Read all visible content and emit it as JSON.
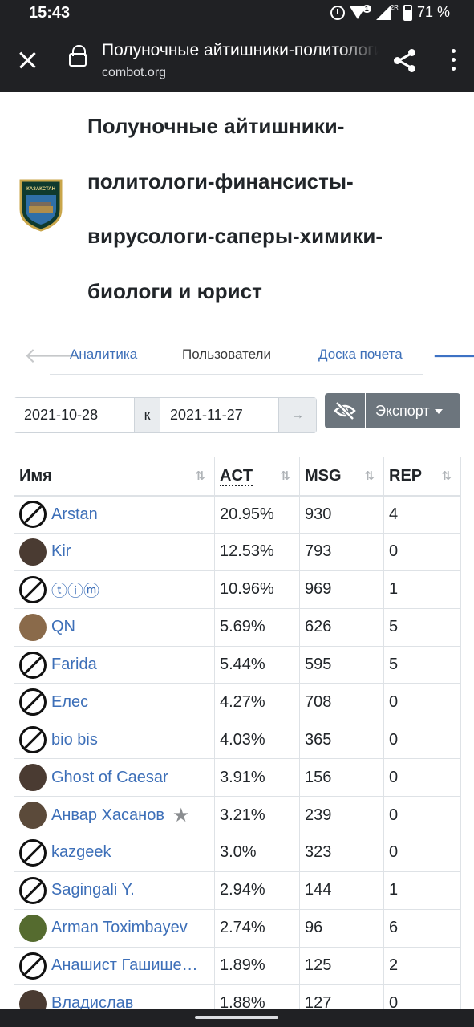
{
  "status_bar": {
    "time": "15:43",
    "badge": "1",
    "network": "2R",
    "battery": "71 %"
  },
  "browser": {
    "page_title": "Полуночные айтишники-политологи-финансисты",
    "url": "combot.org",
    "icons": [
      "close-icon",
      "lock-icon",
      "share-icon",
      "more-vert-icon"
    ]
  },
  "group": {
    "title": "Полуночные айтишники-политологи-финансисты-вирусологи-саперы-химики-биологи и юрист",
    "logo_text": "КАЗАКСТАН"
  },
  "tabs": {
    "items": [
      "Аналитика",
      "Пользователи",
      "Доска почета"
    ],
    "active": "Пользователи"
  },
  "filters": {
    "date_from": "2021-10-28",
    "separator": "к",
    "date_to": "2021-11-27",
    "go": "→",
    "export_label": "Экспорт"
  },
  "table": {
    "headers": [
      "Имя",
      "ACT",
      "MSG",
      "REP"
    ],
    "sort_icon": "⇅",
    "rows": [
      {
        "name": "Arstan",
        "act": "20.95%",
        "msg": "930",
        "rep": "4",
        "avatar": "ban"
      },
      {
        "name": "Kir",
        "act": "12.53%",
        "msg": "793",
        "rep": "0",
        "avatar": "photo"
      },
      {
        "name": "ⓣⓘⓜ",
        "act": "10.96%",
        "msg": "969",
        "rep": "1",
        "avatar": "ban"
      },
      {
        "name": "QN",
        "act": "5.69%",
        "msg": "626",
        "rep": "5",
        "avatar": "photo"
      },
      {
        "name": "Farida",
        "act": "5.44%",
        "msg": "595",
        "rep": "5",
        "avatar": "ban"
      },
      {
        "name": "Елес",
        "act": "4.27%",
        "msg": "708",
        "rep": "0",
        "avatar": "ban"
      },
      {
        "name": "bio bis",
        "act": "4.03%",
        "msg": "365",
        "rep": "0",
        "avatar": "ban"
      },
      {
        "name": "Ghost of Caesar",
        "act": "3.91%",
        "msg": "156",
        "rep": "0",
        "avatar": "photo"
      },
      {
        "name": "Анвар Хасанов",
        "act": "3.21%",
        "msg": "239",
        "rep": "0",
        "avatar": "photo",
        "star": "★"
      },
      {
        "name": "kazgeek",
        "act": "3.0%",
        "msg": "323",
        "rep": "0",
        "avatar": "ban"
      },
      {
        "name": "Sagingali Y.",
        "act": "2.94%",
        "msg": "144",
        "rep": "1",
        "avatar": "ban"
      },
      {
        "name": "Arman Toximbayev",
        "act": "2.74%",
        "msg": "96",
        "rep": "6",
        "avatar": "photo"
      },
      {
        "name": "Анашист Гашишевич",
        "act": "1.89%",
        "msg": "125",
        "rep": "2",
        "avatar": "ban"
      },
      {
        "name": "Владислав",
        "act": "1.88%",
        "msg": "127",
        "rep": "0",
        "avatar": "photo"
      }
    ]
  },
  "colors": {
    "link": "#3d6fb8",
    "button": "#6c757d",
    "chrome": "#202124"
  }
}
